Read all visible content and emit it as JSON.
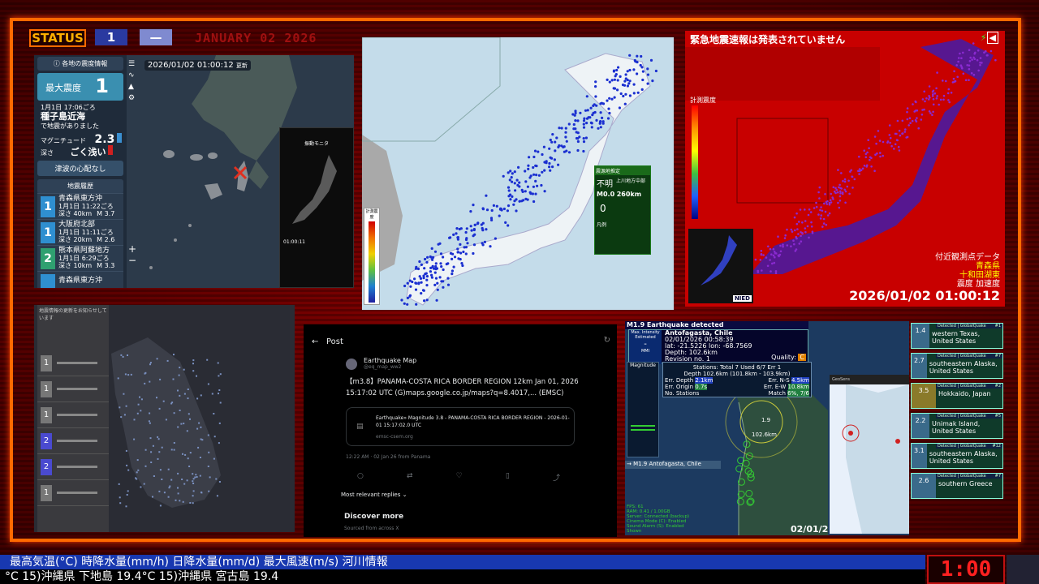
{
  "status_label": "STATUS",
  "status_number": "1",
  "status_dash": "—",
  "top_date": "JANUARY 02 2026",
  "panel1": {
    "header": "各地の震度情報",
    "max_intensity_label": "最大震度",
    "max_intensity": "1",
    "date_time": "1月1日 17:06ごろ",
    "region": "種子島近海",
    "note": "で地震がありました",
    "magnitude_label": "マグニチュード",
    "magnitude": "2.3",
    "depth_label": "深さ",
    "depth": "ごく浅い",
    "tsunami": "津波の心配なし",
    "history_header": "地震履歴",
    "history": [
      {
        "intensity": "1",
        "place": "青森県東方沖",
        "time": "1月1日 11:22ごろ",
        "depth": "深さ 40km",
        "mag": "M 3.7",
        "color": "#2f8fd0"
      },
      {
        "intensity": "1",
        "place": "大阪府北部",
        "time": "1月1日 11:11ごろ",
        "depth": "深さ 20km",
        "mag": "M 2.6",
        "color": "#2f8fd0"
      },
      {
        "intensity": "2",
        "place": "熊本県阿蘇地方",
        "time": "1月1日 6:29ごろ",
        "depth": "深さ 10km",
        "mag": "M 3.3",
        "color": "#2fa070"
      },
      {
        "intensity": "",
        "place": "青森県東方沖",
        "time": "",
        "depth": "",
        "mag": "",
        "color": "#2f8fd0"
      }
    ],
    "map_timestamp": "2026/01/02  01:00:12",
    "map_timestamp_suffix": "更新",
    "phone_title": "振動モニタ",
    "phone_time": "01:00:11"
  },
  "panel2": {
    "rt_header": "震源地推定",
    "rt_unknown": "不明",
    "rt_region": "上川地方中部",
    "rt_mag": "M0.0",
    "rt_depth": "260km",
    "rt_value": "0",
    "legend_title": "計測震度",
    "legend_title2": "凡例"
  },
  "panel3": {
    "title": "緊急地震速報は発表されていません",
    "legend_title": "計測震度",
    "near_title": "付近観測点データ",
    "near_pref": "青森県",
    "near_station": "十和田湖東",
    "near_labels": "震度  加速度",
    "time": "2026/01/02 01:00:12",
    "nied": "NIED"
  },
  "panel4": {
    "header": "地震情報の更新をお知らせしています",
    "items": [
      {
        "n": "1",
        "color": "#777"
      },
      {
        "n": "1",
        "color": "#777"
      },
      {
        "n": "1",
        "color": "#777"
      },
      {
        "n": "2",
        "color": "#4a4ad0"
      },
      {
        "n": "2",
        "color": "#4a4ad0"
      },
      {
        "n": "1",
        "color": "#777"
      }
    ]
  },
  "panel5": {
    "back": "←",
    "title": "Post",
    "account": "Earthquake Map",
    "handle": "@eq_map_ww2",
    "body": "【m3.8】PANAMA-COSTA RICA BORDER REGION 12km Jan 01, 2026 15:17:02 UTC (G)maps.google.co.jp/maps?q=8.4017,... (EMSC)",
    "card_title": "Earthquake» Magnitude 3.8 - PANAMA-COSTA RICA BORDER REGION - 2026-01-01 15:17:02.0 UTC",
    "card_domain": "emsc-csem.org",
    "meta": "12:22 AM · 02 Jan 26 from Panama",
    "replies": "Most relevant replies ⌄",
    "discover": "Discover more",
    "discover_sub": "Sourced from across X"
  },
  "panel6": {
    "banner": "M1.9 Earthquake detected",
    "place": "Antofagasta, Chile",
    "datetime": "02/01/2026 00:58:39",
    "latlon": "lat: -21.5226 lon: -68.7569",
    "depth": "Depth: 102.6km",
    "revision": "Revision no. 1",
    "quality_label": "Quality:",
    "quality": "C",
    "max_int": "Max. Intensity Estimated",
    "max_int_value": "-",
    "mmi": "MMI",
    "stations": "Stations: Total 7 Used 6/7 Err 1",
    "depth_range": "Depth 102.6km (101.8km - 103.9km)",
    "err_depth": "Err. Depth",
    "err_depth_v": "2.1km",
    "err_ns": "Err. N-S",
    "err_ns_v": "4.5km",
    "err_origin": "Err. Origin",
    "err_origin_v": "0.7s",
    "err_ew": "Err. E-W",
    "err_ew_v": "10.8km",
    "no_stations": "No. Stations",
    "match": "Match",
    "match_v": "6%, 7/6",
    "magnitude_label": "Magnitude",
    "lower_banner": "→ M1.9 Antofagasta, Chile",
    "epicenter_label": "1.9",
    "epicenter_depth": "102.6km",
    "fps": "FPS: 61",
    "ram": "RAM: 0.41 / 1.00GB",
    "server": "Server: Connected (backup)",
    "cinema": "Cinema Mode (C): Enabled",
    "sound": "Sound Alarm (S): Enabled",
    "shown": "Shown",
    "date_footer": "02/01/2",
    "inset_title": "GeoSens"
  },
  "panel7": {
    "items": [
      {
        "idx": "#1",
        "mag": "1.4",
        "loc": "western Texas, United States",
        "bg": "#3a6a8a"
      },
      {
        "idx": "#7",
        "mag": "2.7",
        "loc": "southeastern Alaska, United States",
        "bg": "#3a6a8a"
      },
      {
        "idx": "#2",
        "mag": "3.5",
        "loc": "Hokkaido, Japan",
        "bg": "#8a7a2a"
      },
      {
        "idx": "#5",
        "mag": "2.2",
        "loc": "Unimak Island, United States",
        "bg": "#3a6a8a"
      },
      {
        "idx": "#12",
        "mag": "3.1",
        "loc": "southeastern Alaska, United States",
        "bg": "#3a6a8a"
      },
      {
        "idx": "#7",
        "mag": "2.6",
        "loc": "southern Greece",
        "bg": "#3a6a8a"
      }
    ],
    "detected": "Detected | GlobalQuake"
  },
  "ticker": {
    "line1": "最高気温(°C)  時降水量(mm/h)   日降水量(mm/d)   最大風速(m/s)   河川情報",
    "line2": "°C         15)沖縄県 下地島 19.4°C          15)沖縄県 宮古島 19.4"
  },
  "clock": "1:00"
}
